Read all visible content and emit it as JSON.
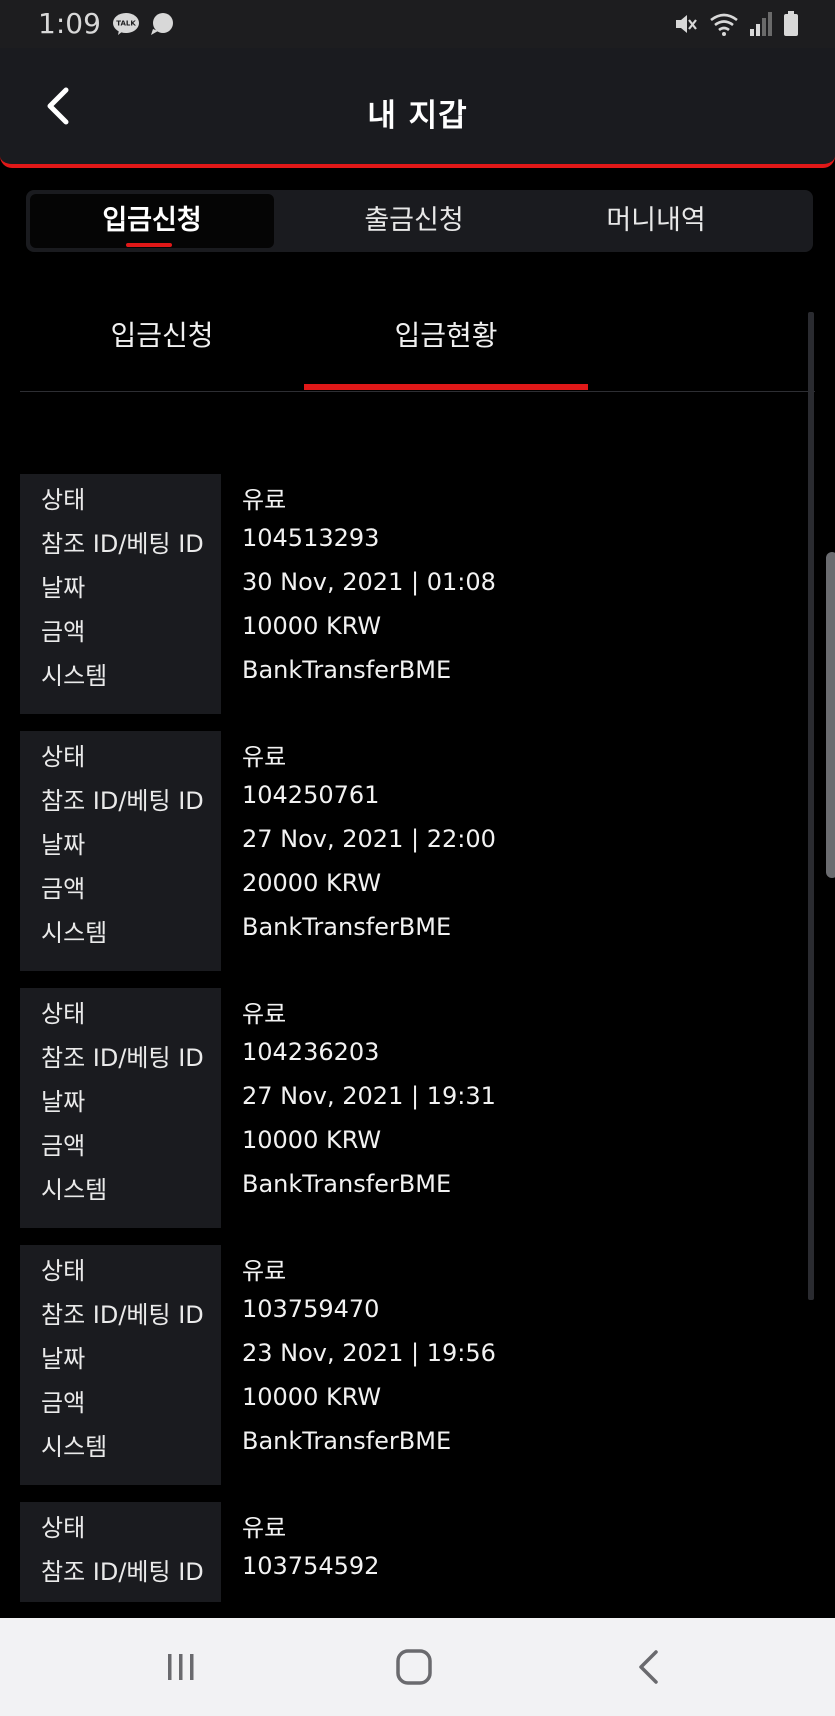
{
  "status_bar": {
    "time": "1:09",
    "left_icons": [
      "kakaotalk-icon",
      "chat-bubble-icon"
    ],
    "right_icons": [
      "mute-icon",
      "wifi-icon",
      "signal-icon",
      "battery-icon"
    ],
    "talk_label": "TALK"
  },
  "header": {
    "title": "내 지갑",
    "back_icon": "chevron-left-icon"
  },
  "segmented_tabs": [
    {
      "label": "입금신청",
      "active": true
    },
    {
      "label": "출금신청",
      "active": false
    },
    {
      "label": "머니내역",
      "active": false
    }
  ],
  "sub_tabs": [
    {
      "label": "입금신청",
      "active": false
    },
    {
      "label": "입금현황",
      "active": true
    }
  ],
  "record_labels": {
    "status": "상태",
    "ref_id": "참조 ID/베팅 ID",
    "date": "날짜",
    "amount": "금액",
    "system": "시스템"
  },
  "records": [
    {
      "status": "유료",
      "ref_id": "104513293",
      "date": "30 Nov, 2021 | 01:08",
      "amount": "10000 KRW",
      "system": "BankTransferBME"
    },
    {
      "status": "유료",
      "ref_id": "104250761",
      "date": "27 Nov, 2021 | 22:00",
      "amount": "20000 KRW",
      "system": "BankTransferBME"
    },
    {
      "status": "유료",
      "ref_id": "104236203",
      "date": "27 Nov, 2021 | 19:31",
      "amount": "10000 KRW",
      "system": "BankTransferBME"
    },
    {
      "status": "유료",
      "ref_id": "103759470",
      "date": "23 Nov, 2021 | 19:56",
      "amount": "10000 KRW",
      "system": "BankTransferBME"
    },
    {
      "status": "유료",
      "ref_id": "103754592"
    }
  ],
  "nav_bar": {
    "icons": [
      "recent-apps-icon",
      "home-icon",
      "back-icon"
    ]
  },
  "colors": {
    "accent": "#e01818",
    "panel": "#1a1b1f",
    "background": "#000000",
    "nav_bar": "#f2f2f4"
  }
}
